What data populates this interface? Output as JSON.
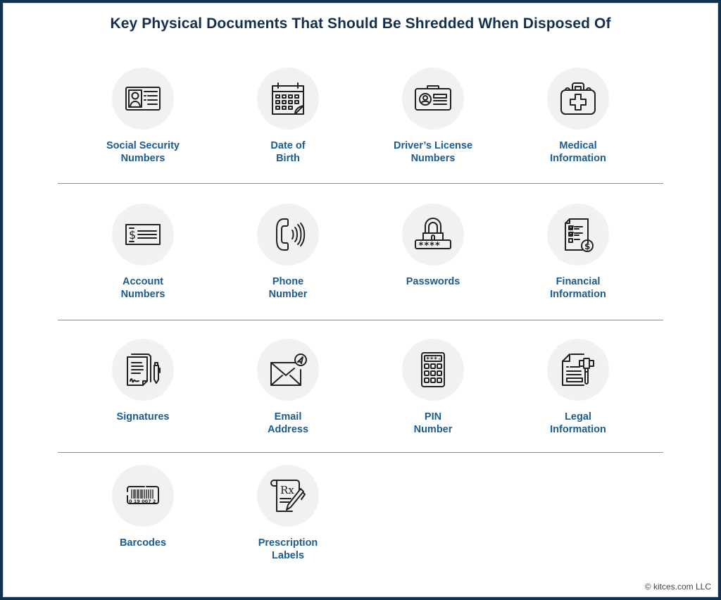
{
  "title": "Key Physical Documents That Should Be Shredded When Disposed Of",
  "colors": {
    "border": "#12304f",
    "title": "#13304f",
    "label": "#1c5b91",
    "circle": "#f1f1f1",
    "divider": "#8c8c8c"
  },
  "rows": [
    {
      "items": [
        {
          "icon": "id-card-icon",
          "lines": [
            "Social Security",
            "Numbers"
          ]
        },
        {
          "icon": "calendar-icon",
          "lines": [
            "Date of",
            "Birth"
          ]
        },
        {
          "icon": "drivers-license-icon",
          "lines": [
            "Driver’s License",
            "Numbers"
          ]
        },
        {
          "icon": "medical-kit-icon",
          "lines": [
            "Medical",
            "Information"
          ]
        }
      ]
    },
    {
      "items": [
        {
          "icon": "check-icon",
          "lines": [
            "Account",
            "Numbers"
          ]
        },
        {
          "icon": "phone-icon",
          "lines": [
            "Phone",
            "Number"
          ]
        },
        {
          "icon": "password-lock-icon",
          "lines": [
            "Passwords"
          ]
        },
        {
          "icon": "financial-document-icon",
          "lines": [
            "Financial",
            "Information"
          ]
        }
      ]
    },
    {
      "items": [
        {
          "icon": "signed-document-icon",
          "lines": [
            "Signatures"
          ]
        },
        {
          "icon": "email-icon",
          "lines": [
            "Email",
            "Address"
          ]
        },
        {
          "icon": "pin-keypad-icon",
          "lines": [
            "PIN",
            "Number"
          ]
        },
        {
          "icon": "legal-gavel-icon",
          "lines": [
            "Legal",
            "Information"
          ]
        }
      ]
    },
    {
      "items": [
        {
          "icon": "barcode-icon",
          "lines": [
            "Barcodes"
          ],
          "barcode_digits": "0 19 007 2"
        },
        {
          "icon": "prescription-icon",
          "lines": [
            "Prescription",
            "Labels"
          ],
          "rx_text": "Rx"
        }
      ]
    }
  ],
  "copyright": "© kitces.com LLC"
}
